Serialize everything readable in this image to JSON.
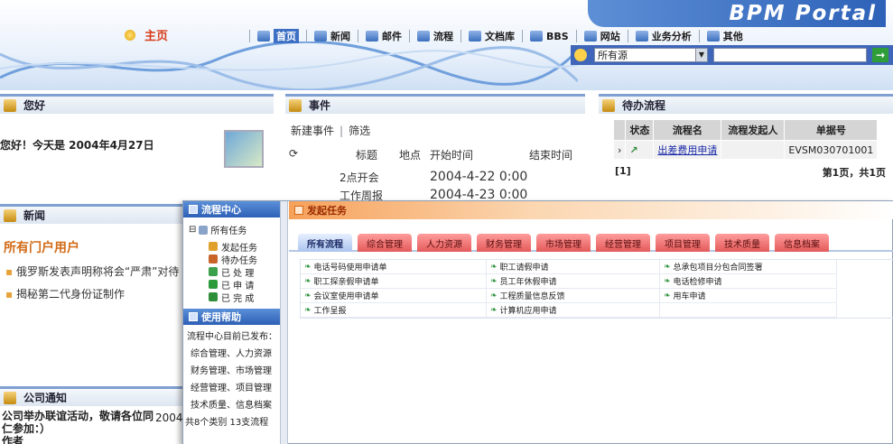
{
  "header": {
    "brand": "BPM Portal",
    "home_label": "主页",
    "nav": [
      {
        "label": "首页",
        "active": true,
        "icon": "home-icon"
      },
      {
        "label": "新闻",
        "icon": "globe-icon"
      },
      {
        "label": "邮件",
        "icon": "mail-icon"
      },
      {
        "label": "流程",
        "icon": "flow-icon"
      },
      {
        "label": "文档库",
        "icon": "docs-icon"
      },
      {
        "label": "BBS",
        "icon": "bbs-icon"
      },
      {
        "label": "网站",
        "icon": "site-icon"
      },
      {
        "label": "业务分析",
        "icon": "analysis-icon"
      },
      {
        "label": "其他",
        "icon": "other-icon"
      }
    ],
    "search": {
      "scope": "所有源",
      "go": "→"
    }
  },
  "hello": {
    "title": "您好",
    "greeting": "您好！今天是 2004年4月27日"
  },
  "events": {
    "title": "事件",
    "new_event": "新建事件",
    "filter": "筛选",
    "columns": {
      "title": "标题",
      "place": "地点",
      "start": "开始时间",
      "end": "结束时间"
    },
    "rows": [
      {
        "title": "2点开会",
        "start": "2004-4-22 0:00"
      },
      {
        "title": "工作周报",
        "start": "2004-4-23 0:00"
      }
    ]
  },
  "pending": {
    "title": "待办流程",
    "columns": [
      "状态",
      "流程名",
      "流程发起人",
      "单据号"
    ],
    "rows": [
      {
        "name": "出差费用申请",
        "initiator": "",
        "doc_no": "EVSM030701001"
      }
    ],
    "pager_left": "[1]",
    "pager_right": "第1页，共1页"
  },
  "news": {
    "title": "新闻",
    "slogan": "所有门户用户",
    "items": [
      "俄罗斯发表声明称将会“严肃”对待",
      "揭秘第二代身份证制作"
    ]
  },
  "notice": {
    "title": "公司通知",
    "text": "公司举办联谊活动，敬请各位同仁参加：）",
    "author": "作者",
    "date": "2004"
  },
  "overlay": {
    "sidebar": {
      "center_title": "流程中心",
      "root": "所有任务",
      "tasks": [
        {
          "label": "发起任务",
          "color": "#e0a02c"
        },
        {
          "label": "待办任务",
          "color": "#c86428"
        },
        {
          "label": "已 处 理",
          "color": "#3aa04a"
        },
        {
          "label": "已 申 请",
          "color": "#2d9a3a"
        },
        {
          "label": "已 完 成",
          "color": "#2f8e38"
        }
      ],
      "help_title": "使用帮助",
      "help_intro": "流程中心目前已发布：",
      "help_lines": [
        "综合管理、人力资源",
        "财务管理、市场管理",
        "经营管理、项目管理",
        "技术质量、信息档案"
      ],
      "summary": "共8个类别 13支流程"
    },
    "main": {
      "title": "发起任务",
      "tabs": [
        "所有流程",
        "综合管理",
        "人力资源",
        "财务管理",
        "市场管理",
        "经营管理",
        "项目管理",
        "技术质量",
        "信息档案"
      ],
      "processes": [
        "电话号码使用申请单",
        "职工请假申请",
        "总承包项目分包合同签署",
        "职工探亲假申请单",
        "员工年休假申请",
        "电话检修申请",
        "会议室使用申请单",
        "工程质量信息反馈",
        "用车申请",
        "工作呈报",
        "计算机应用申请",
        ""
      ]
    }
  }
}
